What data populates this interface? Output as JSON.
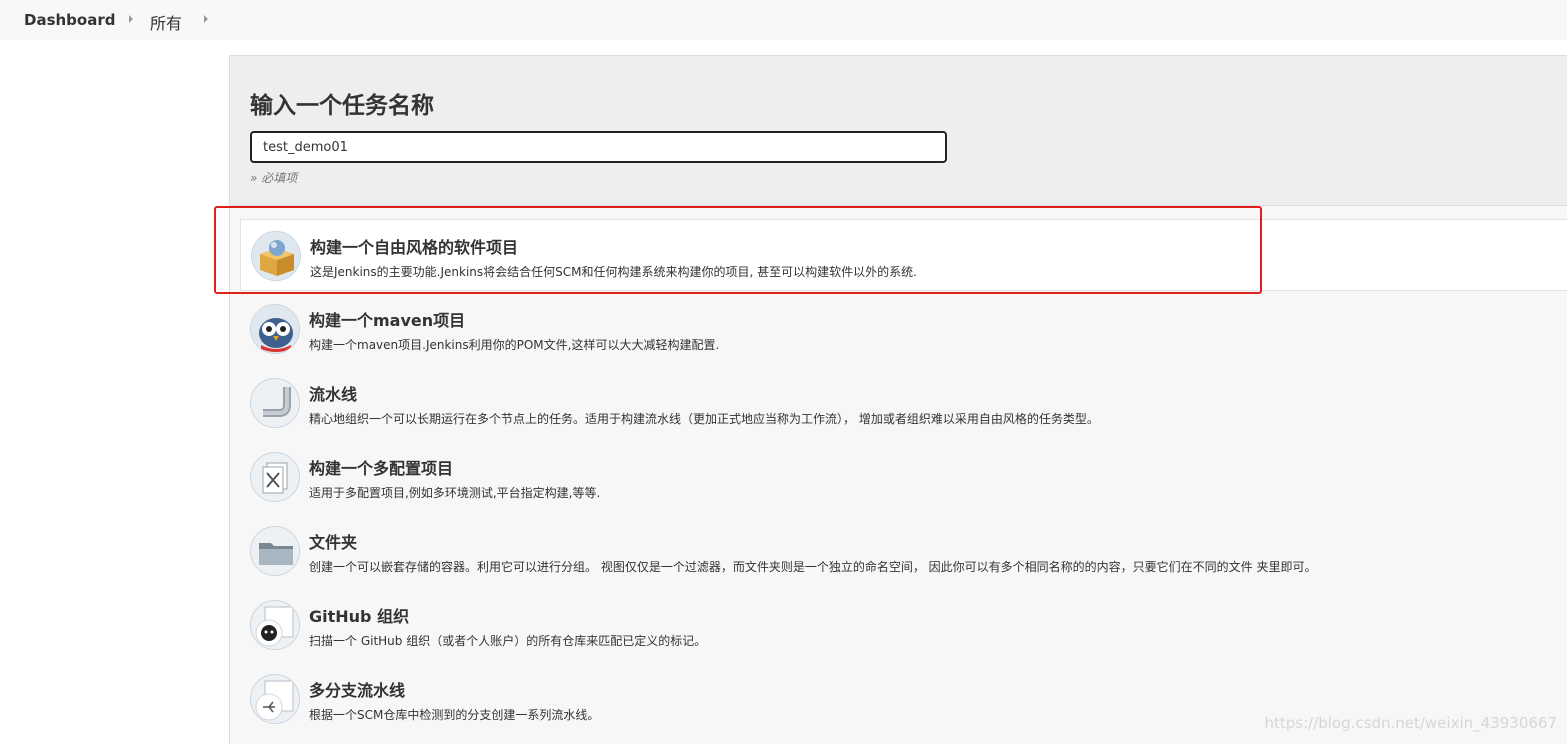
{
  "breadcrumb": {
    "dashboard": "Dashboard",
    "all": "所有"
  },
  "form": {
    "title": "输入一个任务名称",
    "name_value": "test_demo01",
    "required_hint": "» 必填项"
  },
  "items": [
    {
      "label": "构建一个自由风格的软件项目",
      "description": "这是Jenkins的主要功能.Jenkins将会结合任何SCM和任何构建系统来构建你的项目, 甚至可以构建软件以外的系统.",
      "icon": "freestyle-box-icon",
      "selected": true
    },
    {
      "label": "构建一个maven项目",
      "description": "构建一个maven项目.Jenkins利用你的POM文件,这样可以大大减轻构建配置.",
      "icon": "maven-owl-icon",
      "selected": false
    },
    {
      "label": "流水线",
      "description": "精心地组织一个可以长期运行在多个节点上的任务。适用于构建流水线（更加正式地应当称为工作流）， 增加或者组织难以采用自由风格的任务类型。",
      "icon": "pipeline-pipe-icon",
      "selected": false
    },
    {
      "label": "构建一个多配置项目",
      "description": "适用于多配置项目,例如多环境测试,平台指定构建,等等.",
      "icon": "multi-config-icon",
      "selected": false
    },
    {
      "label": "文件夹",
      "description": "创建一个可以嵌套存储的容器。利用它可以进行分组。 视图仅仅是一个过滤器，而文件夹则是一个独立的命名空间， 因此你可以有多个相同名称的的内容，只要它们在不同的文件 夹里即可。",
      "icon": "folder-icon",
      "selected": false
    },
    {
      "label": "GitHub 组织",
      "description": "扫描一个 GitHub 组织（或者个人账户）的所有仓库来匹配已定义的标记。",
      "icon": "github-org-icon",
      "selected": false
    },
    {
      "label": "多分支流水线",
      "description": "根据一个SCM仓库中检测到的分支创建一系列流水线。",
      "icon": "multibranch-icon",
      "selected": false
    }
  ],
  "watermark": "https://blog.csdn.net/weixin_43930667",
  "colors": {
    "highlight": "#e0201c",
    "panel_bg": "#f7f7f7",
    "header_bg": "#eeeeee"
  }
}
